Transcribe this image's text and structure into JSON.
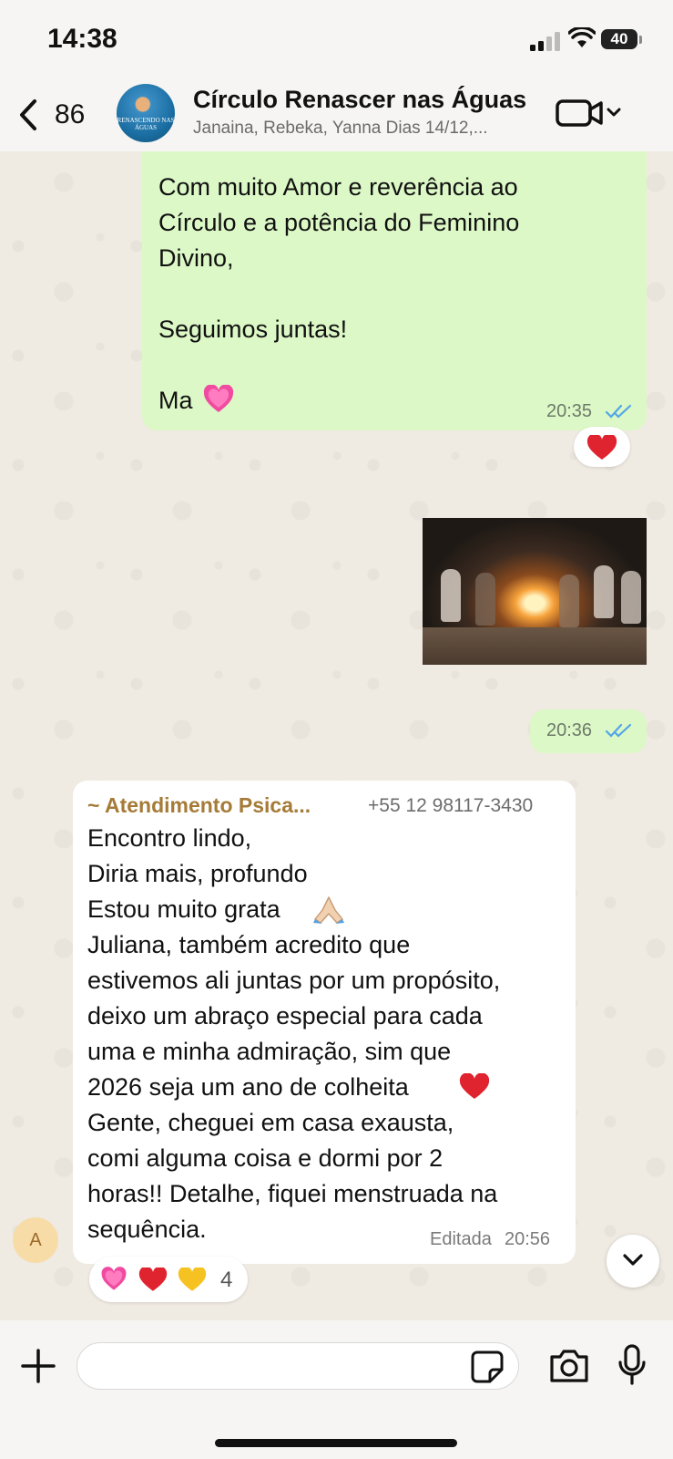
{
  "status_bar": {
    "time": "14:38",
    "battery": "40"
  },
  "header": {
    "back_count": "86",
    "title": "Círculo Renascer nas Águas",
    "subtitle": "Janaina, Rebeka, Yanna Dias 14/12,...",
    "avatar_text": "RENASCENDO NAS ÁGUAS"
  },
  "messages": [
    {
      "direction": "outgoing",
      "lines": [
        "Com muito Amor e reverência ao",
        "Círculo e a potência do Feminino",
        "Divino,",
        "",
        "Seguimos juntas!",
        "",
        "Ma"
      ],
      "time": "20:35",
      "read": true,
      "reaction": "heart"
    },
    {
      "direction": "outgoing",
      "type": "image",
      "time": "20:36",
      "read": true
    },
    {
      "direction": "incoming",
      "sender": "~ Atendimento Psica...",
      "phone": "+55 12 98117-3430",
      "lines": [
        "Encontro lindo,",
        "Diria mais, profundo",
        "Estou muito grata",
        "Juliana, também acredito que",
        "estivemos ali juntas por um propósito,",
        "deixo um abraço especial para cada",
        "uma e minha admiração, sim que",
        "2026 seja um ano de colheita",
        "Gente, cheguei em casa exausta,",
        "comi alguma coisa e dormi por 2",
        "horas!! Detalhe, fiquei menstruada na",
        "sequência."
      ],
      "edited_label": "Editada",
      "time": "20:56",
      "avatar_letter": "A",
      "reactions_count": "4"
    }
  ],
  "input": {
    "placeholder": "",
    "value": ""
  },
  "colors": {
    "outgoing_bubble": "#dcf8c6",
    "incoming_bubble": "#ffffff",
    "sender_name": "#a57b37",
    "read_ticks": "#53a6e8",
    "wallpaper": "#efeae2"
  }
}
